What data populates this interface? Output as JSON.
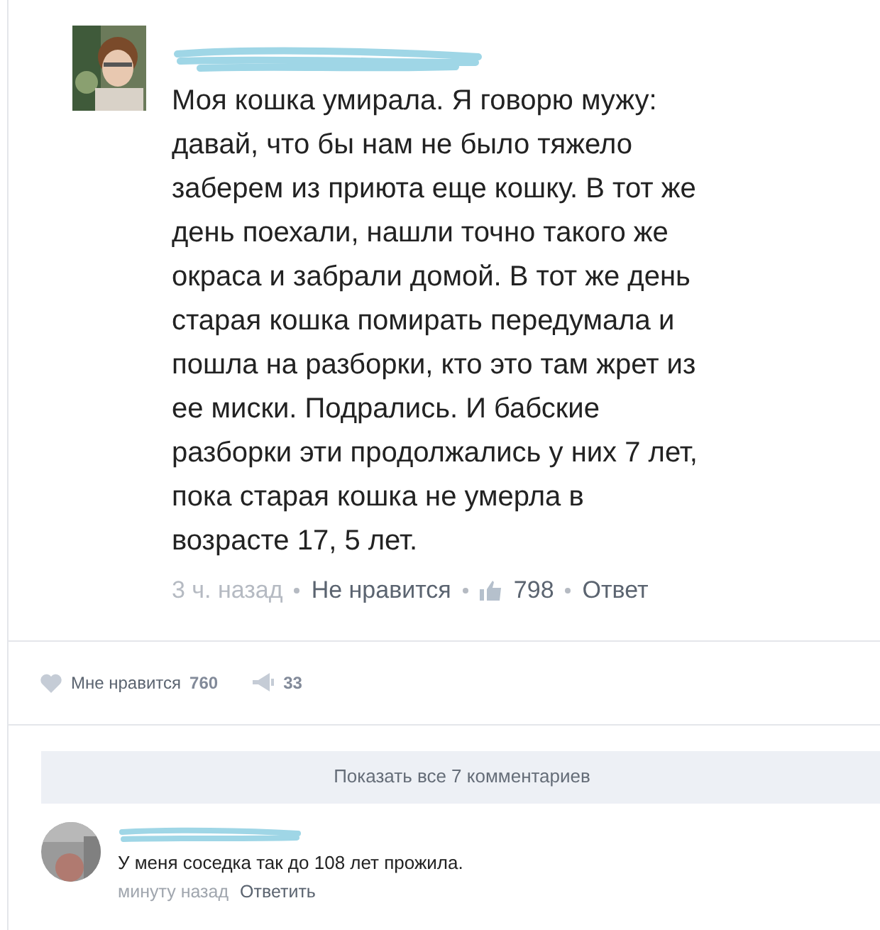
{
  "post": {
    "text": "Моя кошка умирала. Я говорю мужу: давай, что бы нам не было тяжело заберем из приюта еще кошку. В тот же день поехали, нашли точно такого же окраса и забрали домой. В тот же день старая кошка помирать передумала и пошла на разборки, кто это там жрет из ее миски. Подрались. И бабские разборки эти продолжались у них 7 лет, пока старая кошка не умерла в возрасте 17, 5 лет.",
    "time": "3 ч. назад",
    "dislike": "Не нравится",
    "likes": "798",
    "reply": "Ответ"
  },
  "stats": {
    "like_label": "Мне нравится",
    "like_count": "760",
    "share_count": "33"
  },
  "show_all": "Показать все 7 комментариев",
  "comment": {
    "text": "У меня соседка так до 108 лет прожила.",
    "time": "минуту назад",
    "reply": "Ответить"
  }
}
